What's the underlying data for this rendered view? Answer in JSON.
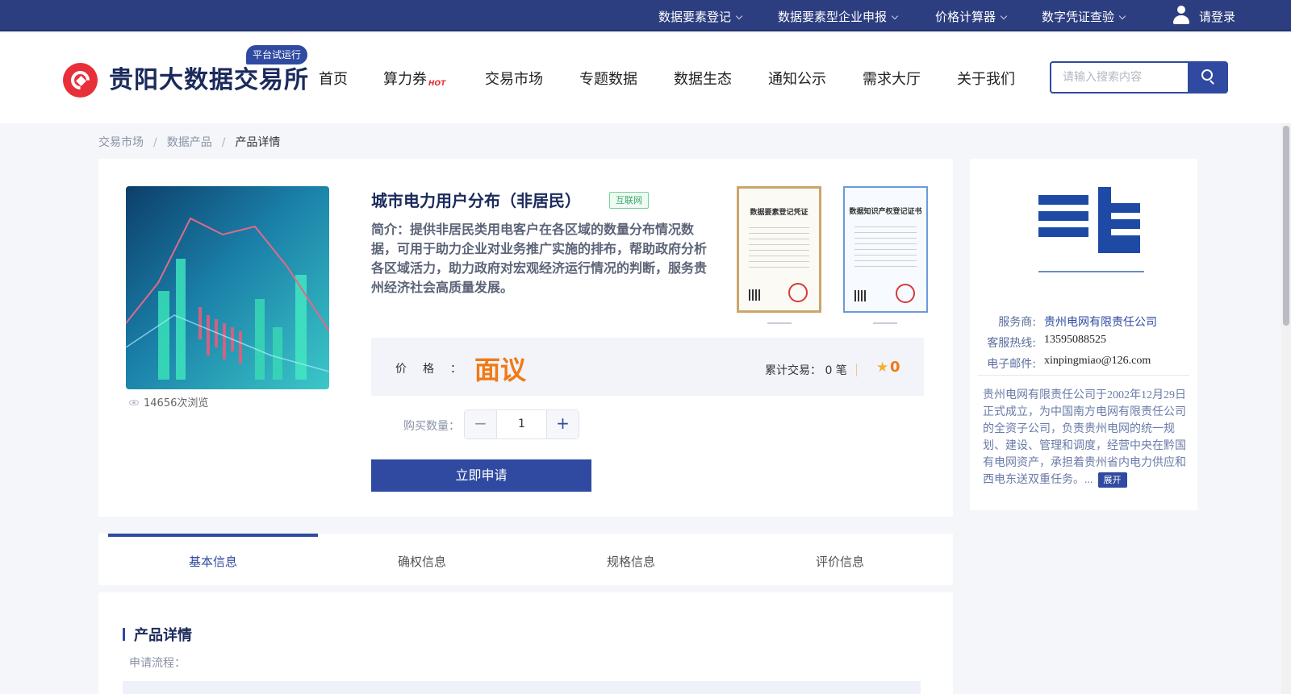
{
  "topbar": {
    "links": [
      "数据要素登记",
      "数据要素型企业申报",
      "价格计算器",
      "数字凭证查验"
    ],
    "login_label": "请登录"
  },
  "header": {
    "logo_text": "贵阳大数据交易所",
    "trial_badge": "平台试运行",
    "nav": [
      "首页",
      "算力券",
      "交易市场",
      "专题数据",
      "数据生态",
      "通知公示",
      "需求大厅",
      "关于我们"
    ],
    "hot_badge": "HOT",
    "search_placeholder": "请输入搜索内容"
  },
  "breadcrumb": [
    "交易市场",
    "数据产品",
    "产品详情"
  ],
  "product": {
    "views": "14656次浏览",
    "title": "城市电力用户分布（非居民）",
    "tag": "互联网",
    "intro": "简介：提供非居民类用电客户在各区域的数量分布情况数据，可用于助力企业对业务推广实施的排布，帮助政府分析各区域活力，助力政府对宏观经济运行情况的判断，服务贵州经济社会高质量发展。",
    "certificates": [
      "数据要素登记凭证",
      "数据知识产权登记证书"
    ],
    "price_label": "价格：",
    "price_value": "面议",
    "deals_label": "累计交易：",
    "deals_value": "0 笔",
    "score": "0",
    "qty_label": "购买数量：",
    "qty_value": "1",
    "apply_button": "立即申请"
  },
  "provider": {
    "name_label": "服务商:",
    "name": "贵州电网有限责任公司",
    "phone_label": "客服热线:",
    "phone": "13595088525",
    "email_label": "电子邮件:",
    "email": "xinpingmiao@126.com",
    "description": "贵州电网有限责任公司于2002年12月29日正式成立，为中国南方电网有限责任公司的全资子公司，负责贵州电网的统一规划、建设、管理和调度，经营中央在黔国有电网资产，承担着贵州省内电力供应和西电东送双重任务。...",
    "expand_label": "展开"
  },
  "tabs": [
    "基本信息",
    "确权信息",
    "规格信息",
    "评价信息"
  ],
  "details": {
    "section_title": "产品详情",
    "apply_flow_label": "申请流程："
  },
  "colors": {
    "primary": "#2f4aa0",
    "topbar": "#2c3e80",
    "price": "#f07a16",
    "brand_red": "#e8303a"
  }
}
